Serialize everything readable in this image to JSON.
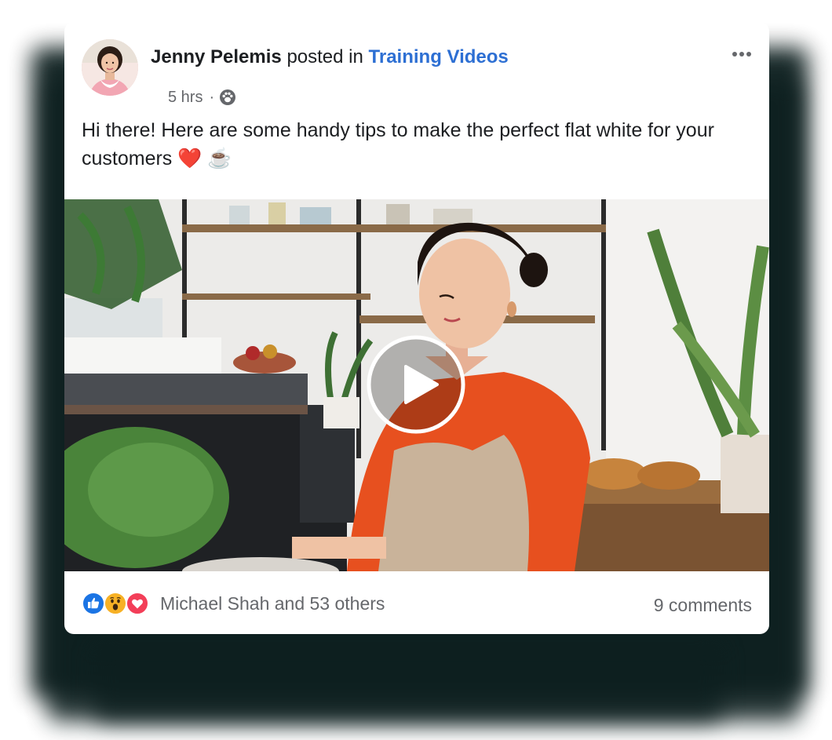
{
  "post": {
    "author": "Jenny Pelemis",
    "posted_in": "posted in",
    "group": "Training Videos",
    "time": "5 hrs",
    "separator": "·",
    "audience_icon": "group-paw-icon",
    "message": "Hi there! Here are some handy tips to make the perfect flat white for your customers ❤️ ☕"
  },
  "video": {
    "play_icon": "play-icon"
  },
  "footer": {
    "reactions": [
      "like-icon",
      "wow-icon",
      "love-icon"
    ],
    "reactors": "Michael Shah and 53 others",
    "comments": "9 comments"
  },
  "colors": {
    "link": "#2d6fd3",
    "text": "#1c1e21",
    "secondary": "#65676b",
    "like": "#1b74e4",
    "wow": "#f7b125",
    "love": "#f33e58"
  }
}
